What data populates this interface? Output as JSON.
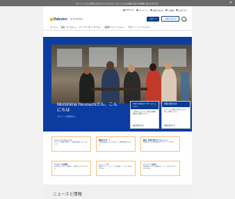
{
  "banner": {
    "text": "ログインしていない状態でご覧いただいております。ログインするとお客様に合わせた情報をご覧いただけます。",
    "close": "×"
  },
  "utility": {
    "items": [
      {
        "label": "Follow Us",
        "icon": "globe-icon"
      },
      {
        "label": "マイページ",
        "icon": "user-icon"
      },
      {
        "label": "お問い合わせ",
        "icon": "chat-icon"
      },
      {
        "label": "日本語",
        "icon": "language-icon"
      },
      {
        "label": "ログアウト",
        "icon": "logout-icon"
      }
    ]
  },
  "brand": {
    "name": "Rakuten",
    "subtitle": "for business",
    "primary_action": "ログイン",
    "secondary_action": "お問い合わせ"
  },
  "nav": {
    "items": [
      "ホーム",
      "製品・サービス",
      "パートナーネットワーク",
      "業種別ソリューション",
      "サポート・トレーニング"
    ]
  },
  "hero": {
    "greeting": "Morishima Hiromichiさん、こんにちは",
    "sub": "プロフィールを確認する",
    "card_left": {
      "title": "Web Cafeのユーザーコミュニティ",
      "body": "ご利用いただいている製品の最新情報をご確認ください",
      "link": "最新情報を見る"
    },
    "card_right": {
      "title": "問題の解決方法",
      "body": "サポートにお問い合わせいただく前にご確認ください",
      "link": "問題を解決する"
    }
  },
  "tiles": [
    {
      "title": "コミュニティセッション",
      "body": "オンライン講座に参加して、最新の情報を入手しましょう。"
    },
    {
      "title": "製品のサポート",
      "body": "ご使用の製品についてのサポート情報を確認できます。"
    },
    {
      "title": "製品・技術に関するドキュメント",
      "body": "製品の使い方や技術資料をダウンロードできます。"
    },
    {
      "title": "ライセンスの管理",
      "body": "お持ちのライセンスを確認し、管理することができます。"
    },
    {
      "title": "トレーニング",
      "body": "製品のトレーニングコースを受講して、スキルを向上できます。"
    },
    {
      "title": "パートナーを探す",
      "body": "お客様のビジネスに最適なパートナーを見つけることができます。"
    }
  ],
  "news": {
    "title": "ニュースと情報"
  },
  "colors": {
    "brand_blue": "#0b3d91",
    "hero_blue": "#0b3da0",
    "tile_border": "#f5c27a"
  }
}
